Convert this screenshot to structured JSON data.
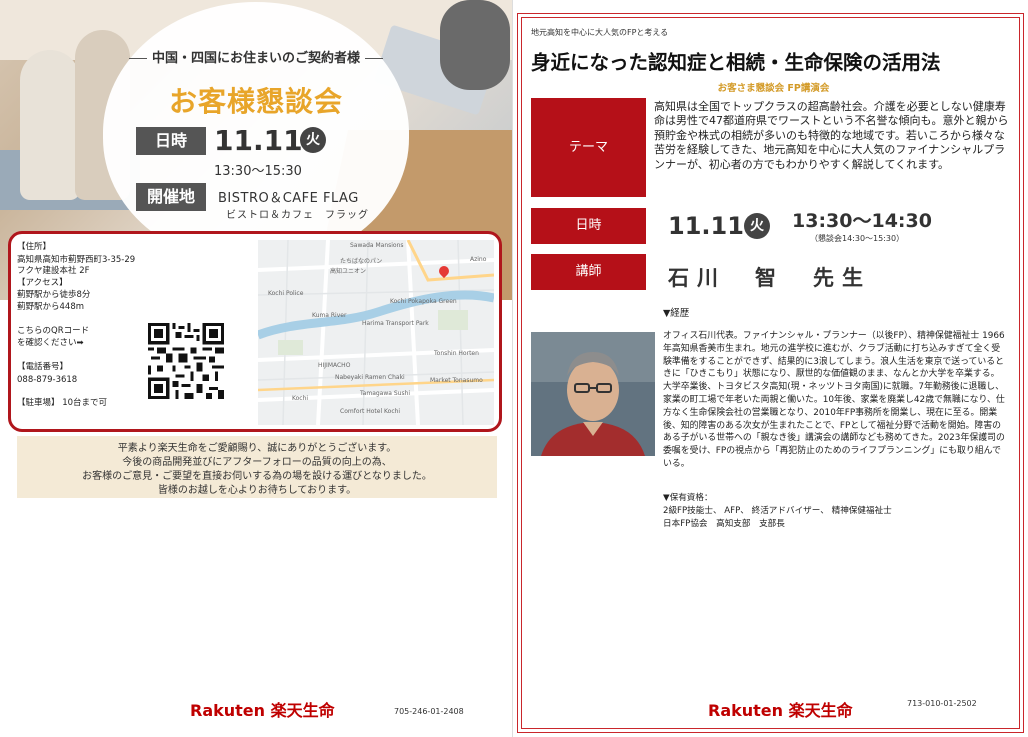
{
  "left": {
    "subheading": "中国・四国にお住まいのご契約者様",
    "title": "お客様懇談会",
    "date_label": "日時",
    "date": "11.11",
    "weekday": "火",
    "time": "13:30～15:30",
    "venue_label": "開催地",
    "venue_name": "BISTRO＆CAFE FLAG",
    "venue_kana": "ビストロ＆カフェ　フラッグ",
    "address_label": "【住所】",
    "address_line1": "高知県高知市蓟野西町3-35-29",
    "address_line2": "フクヤ建設本社 2F",
    "access_label": "【アクセス】",
    "access_line1": "蓟野駅から徒歩8分",
    "access_line2": "蓟野駅から448m",
    "qr_line1": "こちらのQRコード",
    "qr_line2": "を確認ください➡",
    "phone_label": "【電話番号】",
    "phone": "088-879-3618",
    "parking": "【駐車場】 10台まで可",
    "map_labels": [
      "Sawada Mansions",
      "たちばなのパン",
      "高知ユニオン",
      "Kochi Pokapoka Green",
      "Kochi Police",
      "Kuma River",
      "Harima Transport Park",
      "HIJIMACHO",
      "Tonshin Horten",
      "Market Tonasumo",
      "Nabeyaki Ramen Chaki",
      "Tamagawa Sushi",
      "Comfort Hotel Kochi",
      "Kochi",
      "Azino"
    ],
    "notice_lines": [
      "平素より楽天生命をご愛顧賜り、誠にありがとうございます。",
      "今後の商品開発並びにアフターフォローの品質の向上の為、",
      "お客様のご意見・ご要望を直接お伺いする為の場を設ける運びとなりました。",
      "皆様のお越しを心よりお待ちしております。"
    ],
    "brand": "Rakuten 楽天生命",
    "code": "705-246-01-2408"
  },
  "right": {
    "kicker": "地元高知を中心に大人気のFPと考える",
    "title": "身近になった認知症と相続・生命保険の活用法",
    "subtitle": "お客さま懇談会 FP講演会",
    "theme_label": "テーマ",
    "theme_text": "高知県は全国でトップクラスの超高齢社会。介護を必要としない健康寿命は男性で47都道府県でワーストという不名誉な傾向も。意外と親から預貯金や株式の相続が多いのも特徴的な地域です。若いころから様々な苦労を経験してきた、地元高知を中心に大人気のファイナンシャルプランナーが、初心者の方でもわかりやすく解説してくれます。",
    "datetime_label": "日時",
    "date": "11.11",
    "weekday": "火",
    "time": "13:30～14:30",
    "time_note": "（懇談会14:30～15:30）",
    "lecturer_label": "講師",
    "lecturer_name": "石川　智　先生",
    "career_heading": "▼経歴",
    "bio": "オフィス石川代表。ファイナンシャル・プランナー（以後FP）、精神保健福祉士 1966年高知県香美市生まれ。地元の進学校に進むが、クラブ活動に打ち込みすぎて全く受験準備をすることができず、結果的に3浪してしまう。浪人生活を東京で送っているときに「ひきこもり」状態になり、厭世的な価値観のまま、なんとか大学を卒業する。大学卒業後、トヨタビスタ高知(現・ネッツトヨタ南国)に就職。7年勤務後に退職し、家業の町工場で年老いた両親と働いた。10年後、家業を廃業し42歳で無職になり、仕方なく生命保険会社の営業職となり、2010年FP事務所を開業し、現在に至る。開業後、知的障害のある次女が生まれたことで、FPとして福祉分野で活動を開始。障害のある子がいる世帯への「親なき後」講演会の講師なども務めてきた。2023年保護司の委嘱を受け、FPの視点から「再犯防止のためのライフプランニング」にも取り組んでいる。",
    "qual_heading": "▼保有資格：",
    "qual_line1": "2級FP技能士、 AFP、 終活アドバイザー、 精神保健福祉士",
    "qual_line2": "日本FP協会　高知支部　支部長",
    "brand": "Rakuten 楽天生命",
    "code": "713-010-01-2502"
  },
  "colors": {
    "brand_red": "#bf0000",
    "accent_orange": "#e8a52a",
    "label_red": "#b51018"
  }
}
